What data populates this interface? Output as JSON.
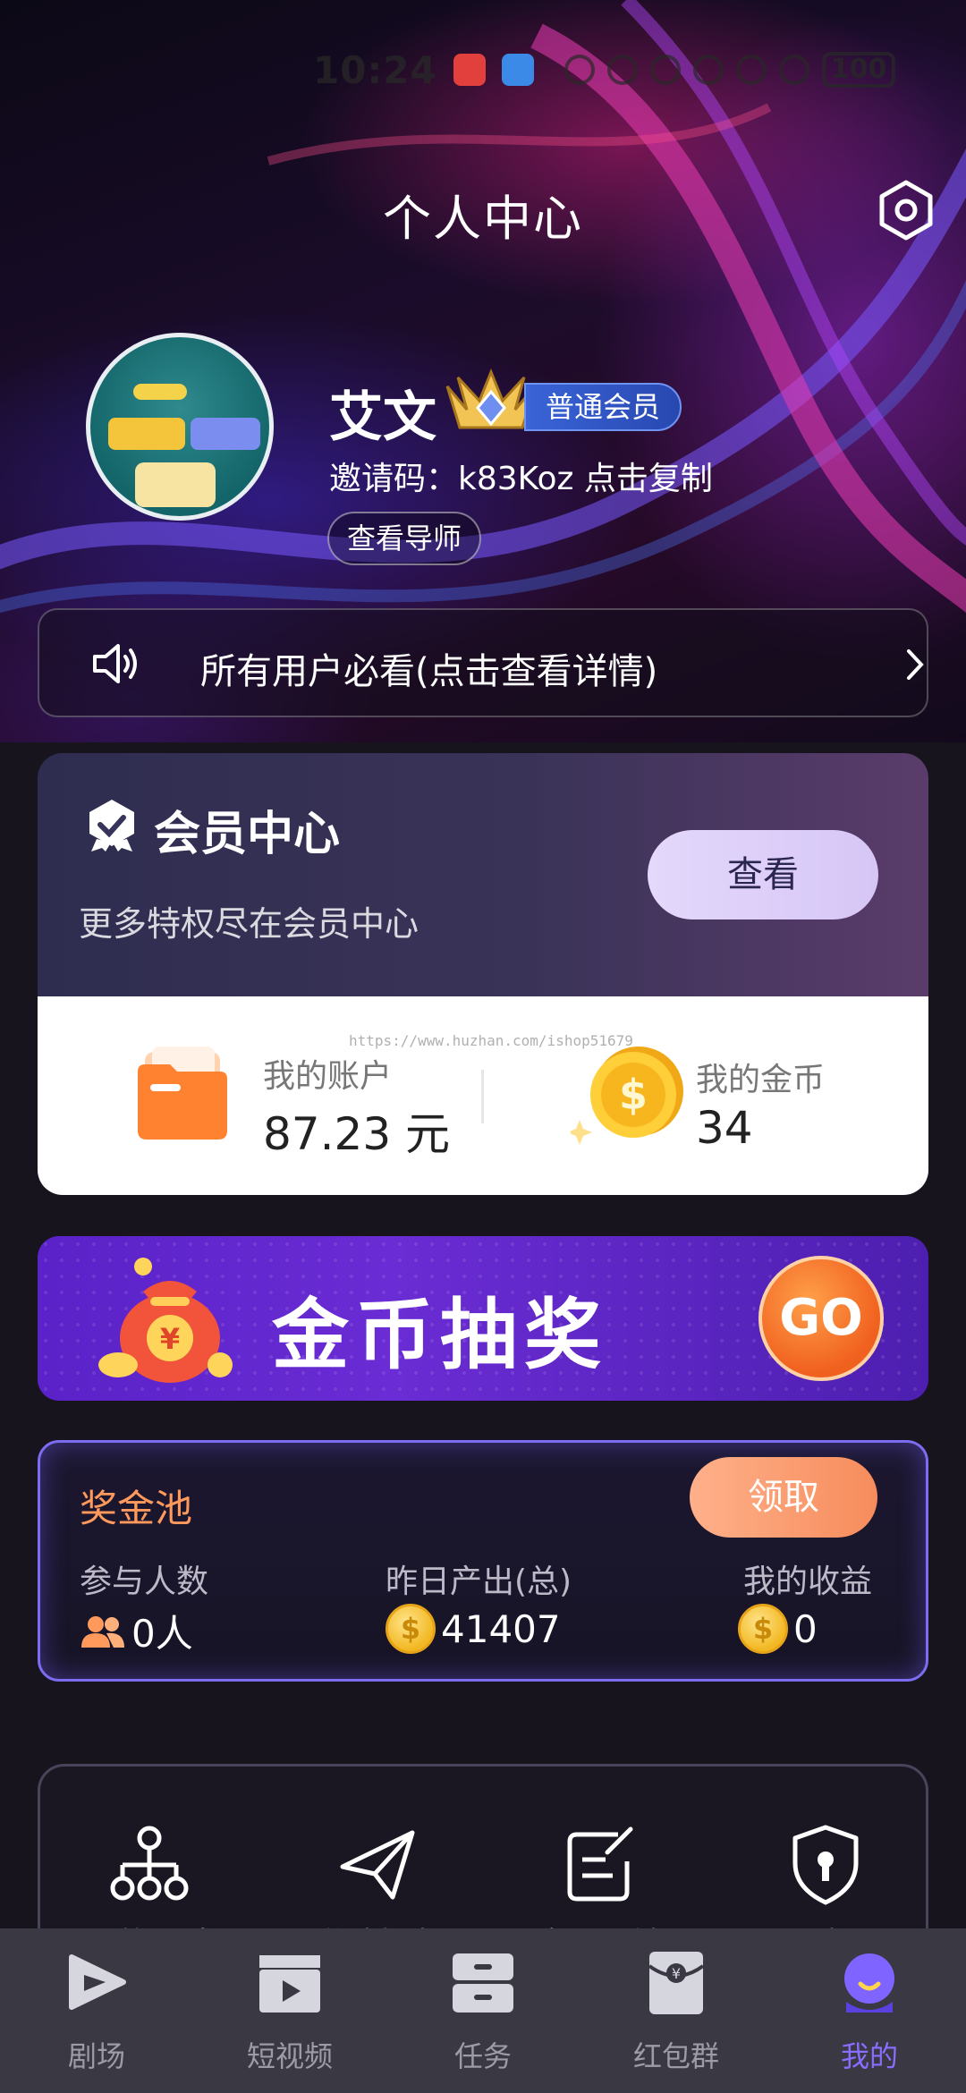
{
  "status_bar": {
    "time": "10:24",
    "battery": "100"
  },
  "header": {
    "title": "个人中心"
  },
  "profile": {
    "username": "艾文",
    "member_level": "普通会员",
    "invite_label": "邀请码：",
    "invite_code": "k83Koz",
    "copy_label": "点击复制",
    "mentor_button": "查看导师"
  },
  "notice": {
    "text": "所有用户必看(点击查看详情)"
  },
  "member_center": {
    "title": "会员中心",
    "subtitle": "更多特权尽在会员中心",
    "view_button": "查看",
    "watermark": "https://www.huzhan.com/ishop51679",
    "account_label": "我的账户",
    "account_value": "87.23 元",
    "gold_label": "我的金币",
    "gold_value": "34"
  },
  "lottery": {
    "title": "金币抽奖",
    "go_button": "GO"
  },
  "prize_pool": {
    "title": "奖金池",
    "claim_button": "领取",
    "participants_label": "参与人数",
    "participants_value": "0人",
    "yesterday_label": "昨日产出(总)",
    "yesterday_value": "41407",
    "earnings_label": "我的收益",
    "earnings_value": "0"
  },
  "tools": [
    {
      "label": "我的团队",
      "icon": "team-tree-icon"
    },
    {
      "label": "邀请好友",
      "icon": "paper-plane-icon"
    },
    {
      "label": "意见反馈",
      "icon": "edit-note-icon"
    },
    {
      "label": "隐私协议",
      "icon": "shield-lock-icon"
    }
  ],
  "bottom_nav": [
    {
      "label": "剧场",
      "icon": "play-icon"
    },
    {
      "label": "短视频",
      "icon": "clapper-icon"
    },
    {
      "label": "任务",
      "icon": "drawer-icon"
    },
    {
      "label": "红包群",
      "icon": "red-envelope-icon"
    },
    {
      "label": "我的",
      "icon": "profile-icon",
      "active": true
    }
  ],
  "colors": {
    "accent_purple": "#8a6cff",
    "orange": "#ff9a5c",
    "gold": "#f2b823"
  }
}
